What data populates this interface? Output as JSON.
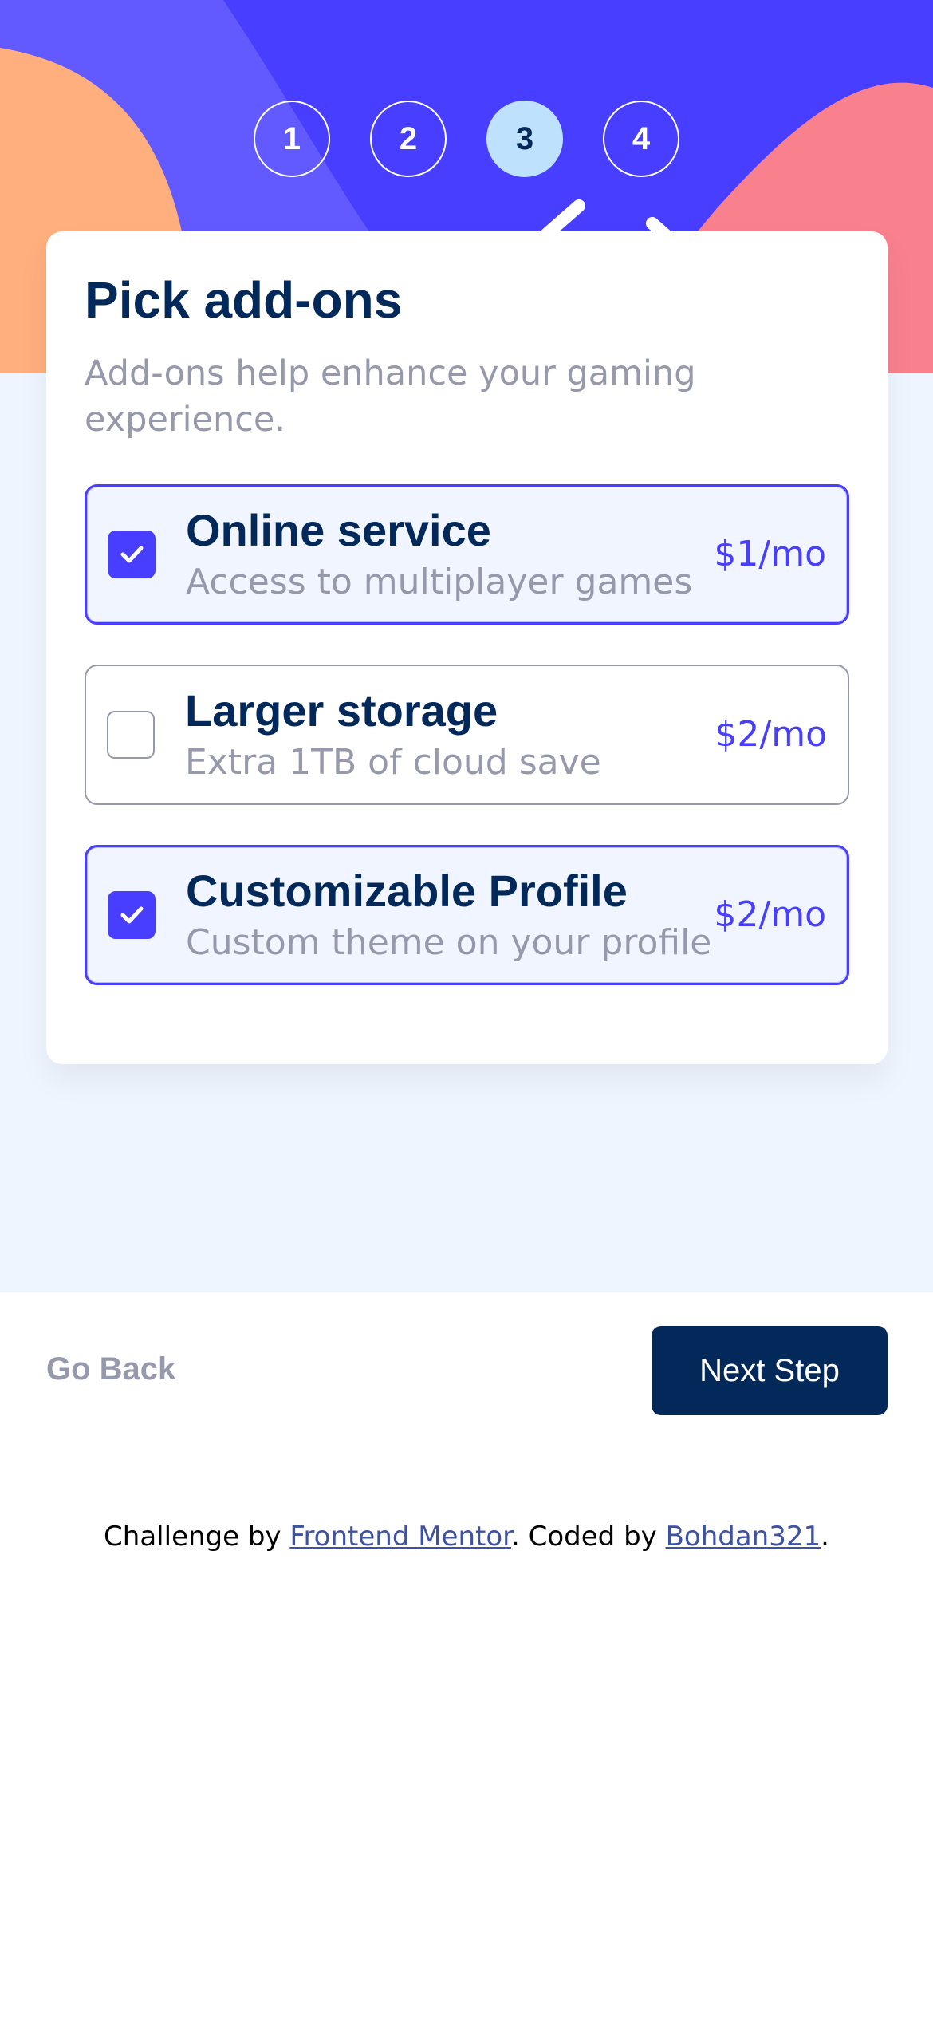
{
  "colors": {
    "hero_purple": "#483eff",
    "hero_orange": "#ffaf7e",
    "hero_pink": "#f9818e",
    "marine_blue": "#02295a",
    "light_blue": "#bee2fd",
    "cool_gray": "#9699ab",
    "magnolia": "#eff5ff"
  },
  "steps": [
    {
      "label": "1",
      "active": false
    },
    {
      "label": "2",
      "active": false
    },
    {
      "label": "3",
      "active": true
    },
    {
      "label": "4",
      "active": false
    }
  ],
  "form": {
    "title": "Pick add-ons",
    "subtitle": "Add-ons help enhance your gaming experience."
  },
  "addons": [
    {
      "name": "Online service",
      "description": "Access to multiplayer games",
      "price": "$1/mo",
      "checked": true
    },
    {
      "name": "Larger storage",
      "description": "Extra 1TB of cloud save",
      "price": "$2/mo",
      "checked": false
    },
    {
      "name": "Customizable Profile",
      "description": "Custom theme on your profile",
      "price": "$2/mo",
      "checked": true
    }
  ],
  "nav": {
    "back_label": "Go Back",
    "next_label": "Next Step"
  },
  "attribution": {
    "prefix": "Challenge by ",
    "link1": "Frontend Mentor",
    "middle": ". Coded by ",
    "link2": "Bohdan321",
    "suffix": "."
  }
}
